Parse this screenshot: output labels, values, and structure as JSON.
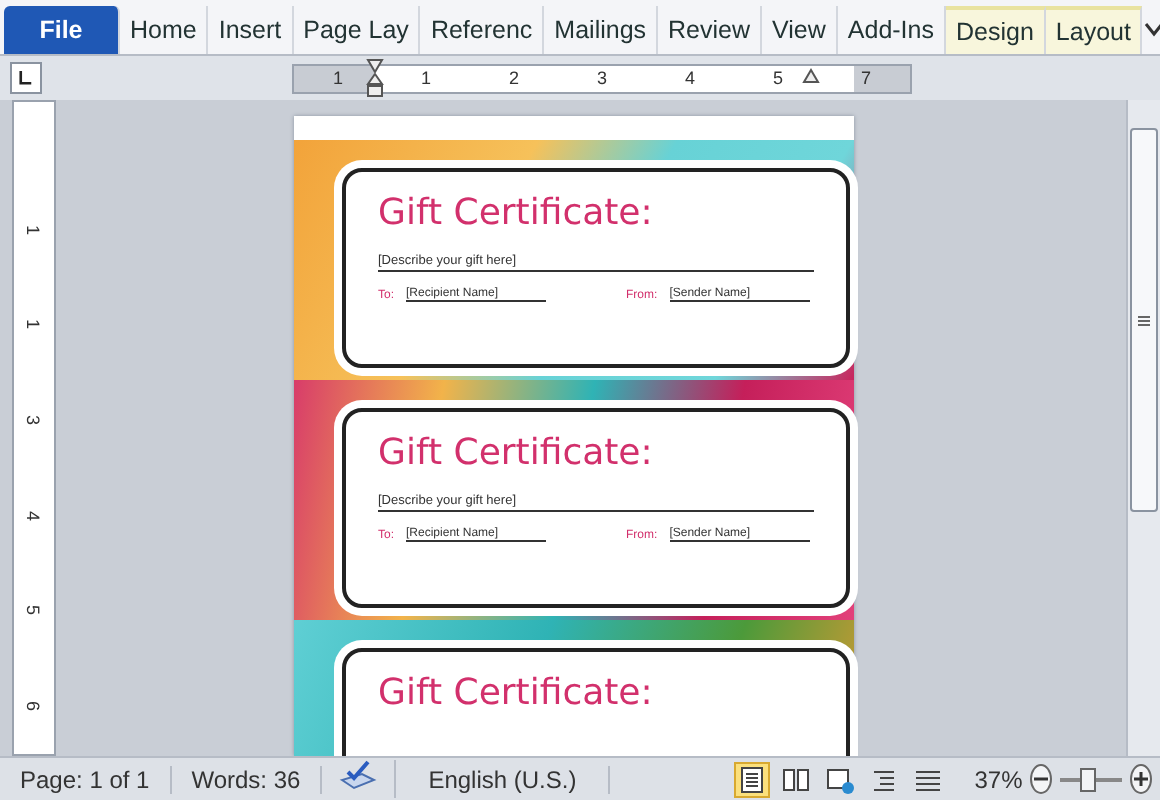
{
  "ribbon": {
    "tabs": [
      {
        "label": "File",
        "selected": true,
        "kind": "file"
      },
      {
        "label": "Home",
        "selected": false,
        "kind": "normal"
      },
      {
        "label": "Insert",
        "selected": false,
        "kind": "normal"
      },
      {
        "label": "Page Lay",
        "selected": false,
        "kind": "normal"
      },
      {
        "label": "Referenc",
        "selected": false,
        "kind": "normal"
      },
      {
        "label": "Mailings",
        "selected": false,
        "kind": "normal"
      },
      {
        "label": "Review",
        "selected": false,
        "kind": "normal"
      },
      {
        "label": "View",
        "selected": false,
        "kind": "normal"
      },
      {
        "label": "Add-Ins",
        "selected": false,
        "kind": "normal"
      },
      {
        "label": "Design",
        "selected": false,
        "kind": "contextual"
      },
      {
        "label": "Layout",
        "selected": false,
        "kind": "contextual"
      }
    ]
  },
  "ruler": {
    "labels": [
      "1",
      "1",
      "2",
      "3",
      "4",
      "5",
      "7"
    ]
  },
  "vertical_ruler": {
    "labels": [
      "1",
      "1",
      "3",
      "4",
      "5",
      "6"
    ]
  },
  "certificates": [
    {
      "title": "Gift Certificate:",
      "description": "[Describe your gift here]",
      "to_label": "To:",
      "to_value": "[Recipient Name]",
      "from_label": "From:",
      "from_value": "[Sender Name]"
    },
    {
      "title": "Gift Certificate:",
      "description": "[Describe your gift here]",
      "to_label": "To:",
      "to_value": "[Recipient Name]",
      "from_label": "From:",
      "from_value": "[Sender Name]"
    },
    {
      "title": "Gift Certificate:"
    }
  ],
  "status_bar": {
    "page": "Page: 1 of 1",
    "words": "Words: 36",
    "language": "English (U.S.)",
    "views": [
      {
        "kind": "print",
        "selected": true
      },
      {
        "kind": "reading",
        "selected": false
      },
      {
        "kind": "web",
        "selected": false
      },
      {
        "kind": "outline",
        "selected": false
      },
      {
        "kind": "draft",
        "selected": false
      }
    ],
    "zoom": "37%",
    "zoom_slider": {
      "level": 0.45
    }
  }
}
